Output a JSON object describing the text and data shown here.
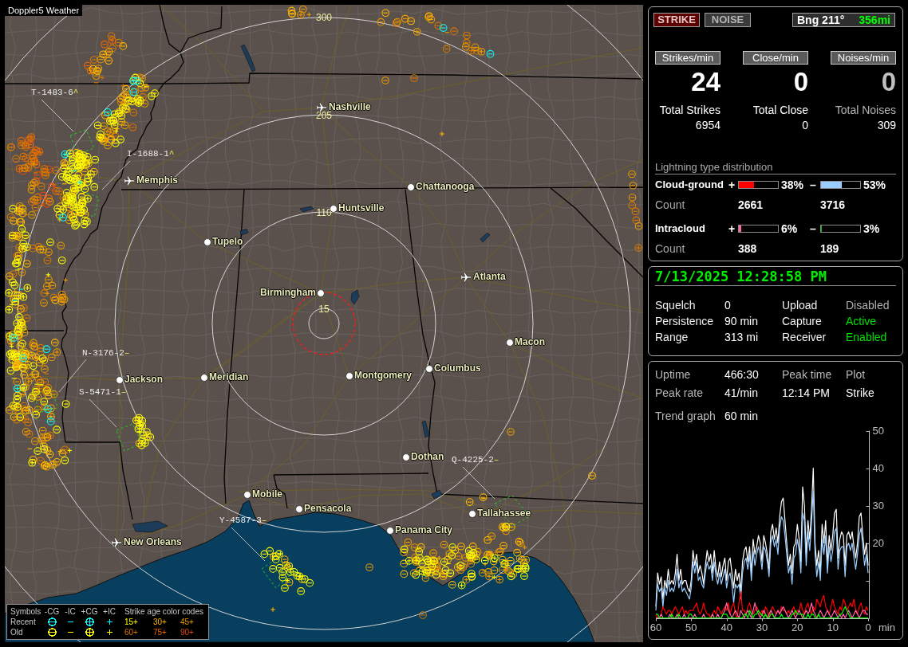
{
  "map": {
    "title": "Doppler5 Weather",
    "range_rings": [
      "300",
      "205",
      "110",
      "15"
    ],
    "cities": [
      {
        "name": "Nashville",
        "kind": "airport"
      },
      {
        "name": "Memphis",
        "kind": "airport"
      },
      {
        "name": "Chattanooga",
        "kind": "city"
      },
      {
        "name": "Huntsville",
        "kind": "city"
      },
      {
        "name": "Tupelo",
        "kind": "city"
      },
      {
        "name": "Atlanta",
        "kind": "airport"
      },
      {
        "name": "Birmingham",
        "kind": "city"
      },
      {
        "name": "Macon",
        "kind": "city"
      },
      {
        "name": "Jackson",
        "kind": "city"
      },
      {
        "name": "Meridian",
        "kind": "city"
      },
      {
        "name": "Montgomery",
        "kind": "city"
      },
      {
        "name": "Columbus",
        "kind": "city"
      },
      {
        "name": "Dothan",
        "kind": "city"
      },
      {
        "name": "Mobile",
        "kind": "city"
      },
      {
        "name": "Pensacola",
        "kind": "city"
      },
      {
        "name": "Tallahassee",
        "kind": "city"
      },
      {
        "name": "Panama City",
        "kind": "city"
      },
      {
        "name": "New Orleans",
        "kind": "airport"
      }
    ],
    "storm_tracks": [
      {
        "id": "T-1483-6",
        "trend": "^"
      },
      {
        "id": "I-1688-1",
        "trend": "^"
      },
      {
        "id": "N-3176-2",
        "trend": "–"
      },
      {
        "id": "S-5471-1",
        "trend": "–"
      },
      {
        "id": "Q-4225-2",
        "trend": "–"
      },
      {
        "id": "Y-4587-3",
        "trend": "–"
      }
    ],
    "legend": {
      "title": "Symbols",
      "symbols": [
        {
          "label": "-CG",
          "kind": "circle_minus"
        },
        {
          "label": "-IC",
          "kind": "minus"
        },
        {
          "label": "+CG",
          "kind": "circle_plus"
        },
        {
          "label": "+IC",
          "kind": "plus"
        }
      ],
      "age_title": "Strike age color codes",
      "rows": [
        {
          "label": "Recent",
          "color": "#00ffff",
          "ages": [
            {
              "label": "15+",
              "color": "#ffff00"
            },
            {
              "label": "30+",
              "color": "#ffb800"
            },
            {
              "label": "45+",
              "color": "#e89a00"
            }
          ]
        },
        {
          "label": "Old",
          "color": "#ffff00",
          "ages": [
            {
              "label": "60+",
              "color": "#d87800"
            },
            {
              "label": "75+",
              "color": "#f06800"
            },
            {
              "label": "90+",
              "color": "#e04810"
            }
          ]
        }
      ]
    }
  },
  "mode_tabs": [
    {
      "label": "STRIKE",
      "selected": true
    },
    {
      "label": "NOISE",
      "selected": false
    }
  ],
  "bearing": {
    "label": "Bng 211°",
    "distance": "356mi"
  },
  "rates": [
    {
      "header": "Strikes/min",
      "value": "24",
      "total_label": "Total Strikes",
      "total": "6954",
      "dimmed": false
    },
    {
      "header": "Close/min",
      "value": "0",
      "total_label": "Total Close",
      "total": "0",
      "dimmed": false
    },
    {
      "header": "Noises/min",
      "value": "0",
      "total_label": "Total Noises",
      "total": "309",
      "dimmed": true
    }
  ],
  "distribution": {
    "title": "Lightning type distribution",
    "types": [
      {
        "name": "Cloud-ground",
        "count_label": "Count",
        "polarities": [
          {
            "sign": "+",
            "level": 0.38,
            "percent": "38%",
            "color": "#ff0000",
            "count": "2661"
          },
          {
            "sign": "–",
            "level": 0.53,
            "percent": "53%",
            "color": "#99ccff",
            "count": "3716"
          }
        ]
      },
      {
        "name": "Intracloud",
        "count_label": "Count",
        "polarities": [
          {
            "sign": "+",
            "level": 0.06,
            "percent": "6%",
            "color": "#ff66aa",
            "count": "388"
          },
          {
            "sign": "–",
            "level": 0.03,
            "percent": "3%",
            "color": "#00c000",
            "count": "189"
          }
        ]
      }
    ]
  },
  "status": {
    "datetime": "7/13/2025 12:28:58 PM",
    "settings": [
      {
        "label": "Squelch",
        "value": "0"
      },
      {
        "label": "Persistence",
        "value": "90 min"
      },
      {
        "label": "Range",
        "value": "313 mi"
      }
    ],
    "services": [
      {
        "label": "Upload",
        "value": "Disabled",
        "on": false
      },
      {
        "label": "Capture",
        "value": "Active",
        "on": true
      },
      {
        "label": "Receiver",
        "value": "Enabled",
        "on": true
      }
    ]
  },
  "summary": {
    "uptime": {
      "label": "Uptime",
      "value": "466:30"
    },
    "peak_time": {
      "label": "Peak time",
      "value": "12:14 PM"
    },
    "plot": {
      "label": "Plot",
      "value": "Strike"
    },
    "peak_rate": {
      "label": "Peak rate",
      "value": "41/min"
    },
    "trend_graph": {
      "label": "Trend graph",
      "value": "60 min"
    },
    "chart_data": {
      "type": "line",
      "xlabel": "min",
      "xlim": [
        60,
        0
      ],
      "ylim": [
        0,
        50
      ],
      "xticks": [
        60,
        50,
        40,
        30,
        20,
        10,
        0
      ],
      "yticks": [
        {
          "value": 10,
          "label": null
        },
        20,
        30,
        40,
        50
      ],
      "x": [
        60,
        59.5,
        59,
        58.5,
        58,
        57.5,
        57,
        56.5,
        56,
        55.5,
        55,
        54.5,
        54,
        53.5,
        53,
        52.5,
        52,
        51.5,
        51,
        50.5,
        50,
        49.5,
        49,
        48.5,
        48,
        47.5,
        47,
        46.5,
        46,
        45.5,
        45,
        44.5,
        44,
        43.5,
        43,
        42.5,
        42,
        41.5,
        41,
        40.5,
        40,
        39.5,
        39,
        38.5,
        38,
        37.5,
        37,
        36.5,
        36,
        35.5,
        35,
        34.5,
        34,
        33.5,
        33,
        32.5,
        32,
        31.5,
        31,
        30.5,
        30,
        29.5,
        29,
        28.5,
        28,
        27.5,
        27,
        26.5,
        26,
        25.5,
        25,
        24.5,
        24,
        23.5,
        23,
        22.5,
        22,
        21.5,
        21,
        20.5,
        20,
        19.5,
        19,
        18.5,
        18,
        17.5,
        17,
        16.5,
        16,
        15.5,
        15,
        14.5,
        14,
        13.5,
        13,
        12.5,
        12,
        11.5,
        11,
        10.5,
        10,
        9.5,
        9,
        8.5,
        8,
        7.5,
        7,
        6.5,
        6,
        5.5,
        5,
        4.5,
        4,
        3.5,
        3,
        2.5,
        2,
        1.5,
        1,
        0.5,
        0
      ],
      "series": [
        {
          "color": "#ffffff",
          "values": [
            3,
            12,
            9,
            11,
            5,
            10,
            8,
            13,
            9,
            10,
            9,
            12,
            17,
            10,
            13,
            9,
            10,
            10,
            8,
            7,
            10,
            18,
            14,
            17,
            12,
            14,
            12,
            9,
            14,
            18,
            15,
            17,
            12,
            18,
            13,
            11,
            15,
            11,
            14,
            16,
            10,
            15,
            16,
            12,
            8,
            13,
            10,
            12,
            7,
            15,
            18,
            19,
            15,
            19,
            12,
            21,
            17,
            19,
            22,
            20,
            15,
            22,
            20,
            17,
            13,
            23,
            25,
            21,
            24,
            20,
            27,
            31,
            32,
            26,
            20,
            14,
            17,
            12,
            19,
            20,
            25,
            21,
            15,
            35,
            30,
            17,
            26,
            21,
            29,
            40,
            20,
            14,
            18,
            12,
            25,
            20,
            26,
            14,
            22,
            18,
            22,
            28,
            29,
            16,
            21,
            23,
            22,
            14,
            22,
            23,
            21,
            23,
            19,
            16,
            20,
            27,
            28,
            22,
            17,
            20,
            14
          ]
        },
        {
          "color": "#99ccff",
          "values": [
            2,
            9,
            7,
            8,
            3,
            8,
            6,
            10,
            7,
            8,
            7,
            9,
            13,
            8,
            10,
            7,
            8,
            7,
            6,
            5,
            8,
            15,
            12,
            15,
            10,
            11,
            9,
            8,
            12,
            15,
            13,
            14,
            10,
            15,
            11,
            9,
            12,
            9,
            11,
            13,
            8,
            11,
            12,
            9,
            4,
            9,
            8,
            9,
            5,
            12,
            15,
            16,
            13,
            17,
            10,
            18,
            14,
            17,
            19,
            17,
            13,
            19,
            18,
            15,
            11,
            20,
            22,
            19,
            21,
            17,
            24,
            27,
            26,
            22,
            17,
            12,
            14,
            9,
            16,
            17,
            21,
            18,
            12,
            28,
            26,
            14,
            23,
            18,
            25,
            34,
            17,
            11,
            15,
            10,
            21,
            17,
            22,
            12,
            19,
            15,
            18,
            23,
            24,
            13,
            18,
            19,
            19,
            11,
            19,
            20,
            18,
            20,
            16,
            13,
            17,
            22,
            24,
            19,
            14,
            17,
            12
          ]
        },
        {
          "color": "#ff0000",
          "values": [
            1,
            0,
            0,
            1,
            3,
            2,
            1,
            2,
            2,
            1,
            2,
            3,
            2,
            1,
            2,
            3,
            1,
            2,
            1,
            2,
            2,
            2,
            3,
            4,
            2,
            1,
            2,
            4,
            2,
            1,
            1,
            0,
            1,
            2,
            1,
            3,
            2,
            1,
            2,
            3,
            2,
            4,
            1,
            3,
            4,
            1,
            0,
            4,
            7,
            2,
            2,
            1,
            3,
            4,
            2,
            1,
            2,
            3,
            2,
            1,
            2,
            1,
            3,
            2,
            0,
            2,
            3,
            2,
            1,
            2,
            1,
            3,
            2,
            2,
            1,
            2,
            1,
            2,
            3,
            1,
            2,
            2,
            4,
            2,
            1,
            3,
            4,
            2,
            1,
            3,
            2,
            5,
            4,
            3,
            5,
            6,
            3,
            2,
            1,
            3,
            5,
            3,
            2,
            1,
            3,
            2,
            5,
            4,
            2,
            3,
            4,
            3,
            5,
            2,
            1,
            3,
            4,
            2,
            1,
            3,
            2
          ]
        },
        {
          "color": "#ff66aa",
          "values": [
            0,
            0,
            0,
            1,
            0,
            0,
            0,
            0,
            1,
            0,
            0,
            0,
            1,
            0,
            0,
            0,
            1,
            0,
            0,
            0,
            0,
            0,
            1,
            0,
            0,
            0,
            0,
            1,
            0,
            0,
            0,
            0,
            1,
            0,
            0,
            1,
            0,
            0,
            1,
            2,
            4,
            2,
            1,
            0,
            1,
            2,
            1,
            0,
            2,
            1,
            0,
            1,
            2,
            1,
            0,
            2,
            4,
            2,
            1,
            0,
            1,
            2,
            1,
            0,
            1,
            2,
            1,
            0,
            1,
            2,
            1,
            2,
            3,
            2,
            1,
            0,
            1,
            2,
            1,
            0,
            1,
            2,
            1,
            0,
            1,
            2,
            1,
            2,
            4,
            2,
            1,
            0,
            1,
            2,
            1,
            0,
            1,
            2,
            1,
            0,
            1,
            2,
            1,
            0,
            1,
            0,
            1,
            0,
            1,
            2,
            1,
            0,
            1,
            2,
            1,
            0,
            1,
            2,
            2,
            1,
            1
          ]
        },
        {
          "color": "#00ff00",
          "values": [
            1,
            1,
            0,
            0,
            0,
            0,
            0,
            0,
            0,
            1,
            0,
            0,
            0,
            1,
            0,
            0,
            0,
            0,
            0,
            1,
            1,
            0,
            0,
            0,
            0,
            0,
            0,
            0,
            0,
            0,
            0,
            0,
            0,
            0,
            0,
            0,
            0,
            0,
            1,
            1,
            1,
            0,
            0,
            0,
            0,
            0,
            0,
            0,
            0,
            0,
            1,
            1,
            0,
            2,
            1,
            0,
            1,
            1,
            2,
            1,
            1,
            0,
            1,
            0,
            0,
            1,
            1,
            0,
            0,
            0,
            0,
            1,
            0,
            0,
            0,
            0,
            0,
            1,
            1,
            2,
            1,
            1,
            1,
            1,
            0,
            0,
            1,
            0,
            1,
            1,
            0,
            0,
            1,
            0,
            0,
            0,
            0,
            0,
            0,
            0,
            0,
            0,
            0,
            0,
            1,
            1,
            2,
            3,
            2,
            1,
            0,
            0,
            0,
            0,
            0,
            0,
            0,
            0,
            0,
            0,
            0
          ]
        }
      ]
    }
  }
}
